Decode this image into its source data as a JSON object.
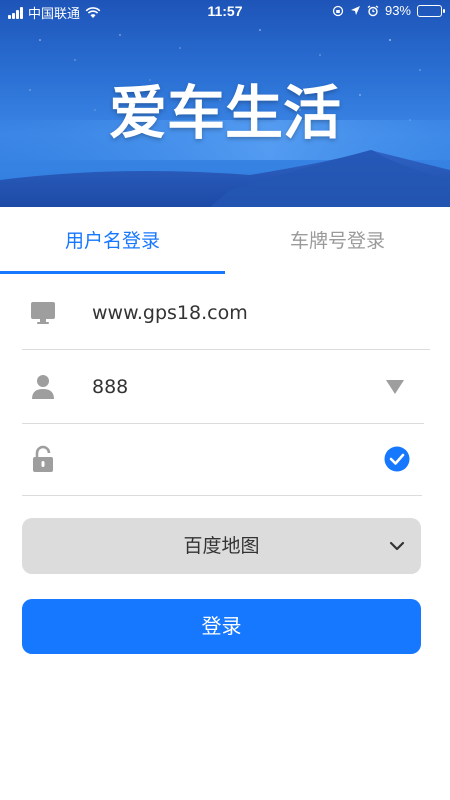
{
  "status_bar": {
    "carrier": "中国联通",
    "time": "11:57",
    "battery": "93%",
    "battery_level": 0.93
  },
  "header": {
    "app_name": "爱车生活"
  },
  "tabs": [
    {
      "label": "用户名登录",
      "active": true
    },
    {
      "label": "车牌号登录",
      "active": false
    }
  ],
  "form": {
    "server": {
      "value": "www.gps18.com",
      "icon": "monitor-icon"
    },
    "username": {
      "value": "888",
      "icon": "user-icon",
      "dropdown_icon": "triangle-down-icon"
    },
    "password": {
      "value": "",
      "icon": "lock-icon",
      "remember_icon": "check-circle-icon",
      "remember_checked": true
    },
    "map_select": {
      "value": "百度地图",
      "icon": "chevron-down-icon"
    },
    "login_button": "登录"
  },
  "colors": {
    "accent": "#1677ff",
    "inactive_tab": "#9a9a9a",
    "select_bg": "#dcdcdc"
  }
}
